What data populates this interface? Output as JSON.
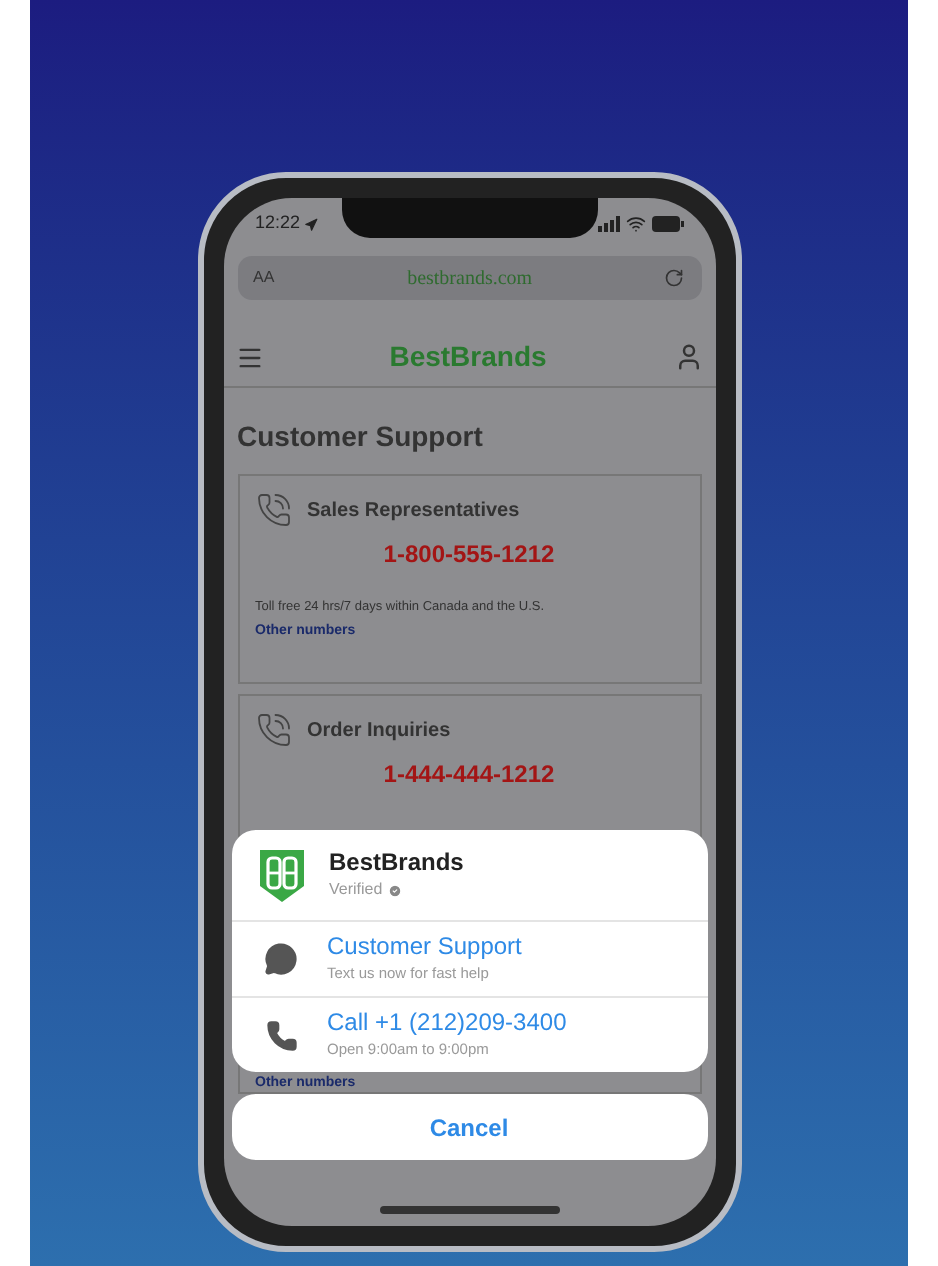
{
  "status_bar": {
    "time": "12:22"
  },
  "address_bar": {
    "text_size": "AA",
    "url": "bestbrands.com"
  },
  "header": {
    "brand": "BestBrands"
  },
  "page_title": "Customer Support",
  "cards": [
    {
      "title": "Sales Representatives",
      "phone": "1-800-555-1212",
      "note": "Toll free 24 hrs/7 days within Canada and the U.S.",
      "link": "Other numbers"
    },
    {
      "title": "Order Inquiries",
      "phone": "1-444-444-1212",
      "link": "Other numbers"
    }
  ],
  "sheet": {
    "business": "BestBrands",
    "verified": "Verified",
    "actions": [
      {
        "kind": "message",
        "title": "Customer Support",
        "subtitle": "Text us now for fast help"
      },
      {
        "kind": "call",
        "title": "Call +1 (212)209-3400",
        "subtitle": "Open 9:00am to 9:00pm"
      }
    ],
    "cancel": "Cancel"
  }
}
